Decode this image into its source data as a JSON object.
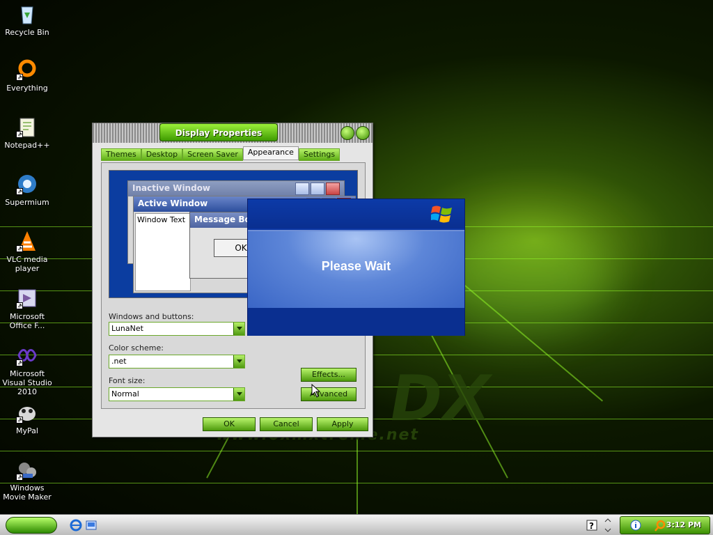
{
  "desktop": {
    "icons": [
      {
        "label": "Recycle Bin",
        "icon": "recycle-bin-icon"
      },
      {
        "label": "Everything",
        "icon": "everything-icon"
      },
      {
        "label": "Notepad++",
        "icon": "notepadpp-icon"
      },
      {
        "label": "Supermium",
        "icon": "supermium-icon"
      },
      {
        "label": "VLC media player",
        "icon": "vlc-icon"
      },
      {
        "label": "Microsoft Office F...",
        "icon": "office-icon"
      },
      {
        "label": "Microsoft Visual Studio 2010",
        "icon": "visual-studio-icon"
      },
      {
        "label": "MyPal",
        "icon": "mypal-icon"
      },
      {
        "label": "Windows Movie Maker",
        "icon": "movie-maker-icon"
      }
    ],
    "watermark": "www.oxmxtreme.net"
  },
  "display_properties": {
    "title": "Display Properties",
    "tabs": [
      "Themes",
      "Desktop",
      "Screen Saver",
      "Appearance",
      "Settings"
    ],
    "active_tab": "Appearance",
    "preview": {
      "inactive_title": "Inactive Window",
      "active_title": "Active Window",
      "window_text": "Window Text",
      "message_box_title": "Message Box",
      "ok_label": "OK"
    },
    "windows_buttons_label": "Windows and buttons:",
    "windows_buttons_value": "LunaNet",
    "color_scheme_label": "Color scheme:",
    "color_scheme_value": ".net",
    "font_size_label": "Font size:",
    "font_size_value": "Normal",
    "effects_label": "Effects...",
    "advanced_label": "Advanced",
    "ok_label": "OK",
    "cancel_label": "Cancel",
    "apply_label": "Apply"
  },
  "please_wait": {
    "text": "Please Wait"
  },
  "taskbar": {
    "clock": "3:12 PM"
  }
}
